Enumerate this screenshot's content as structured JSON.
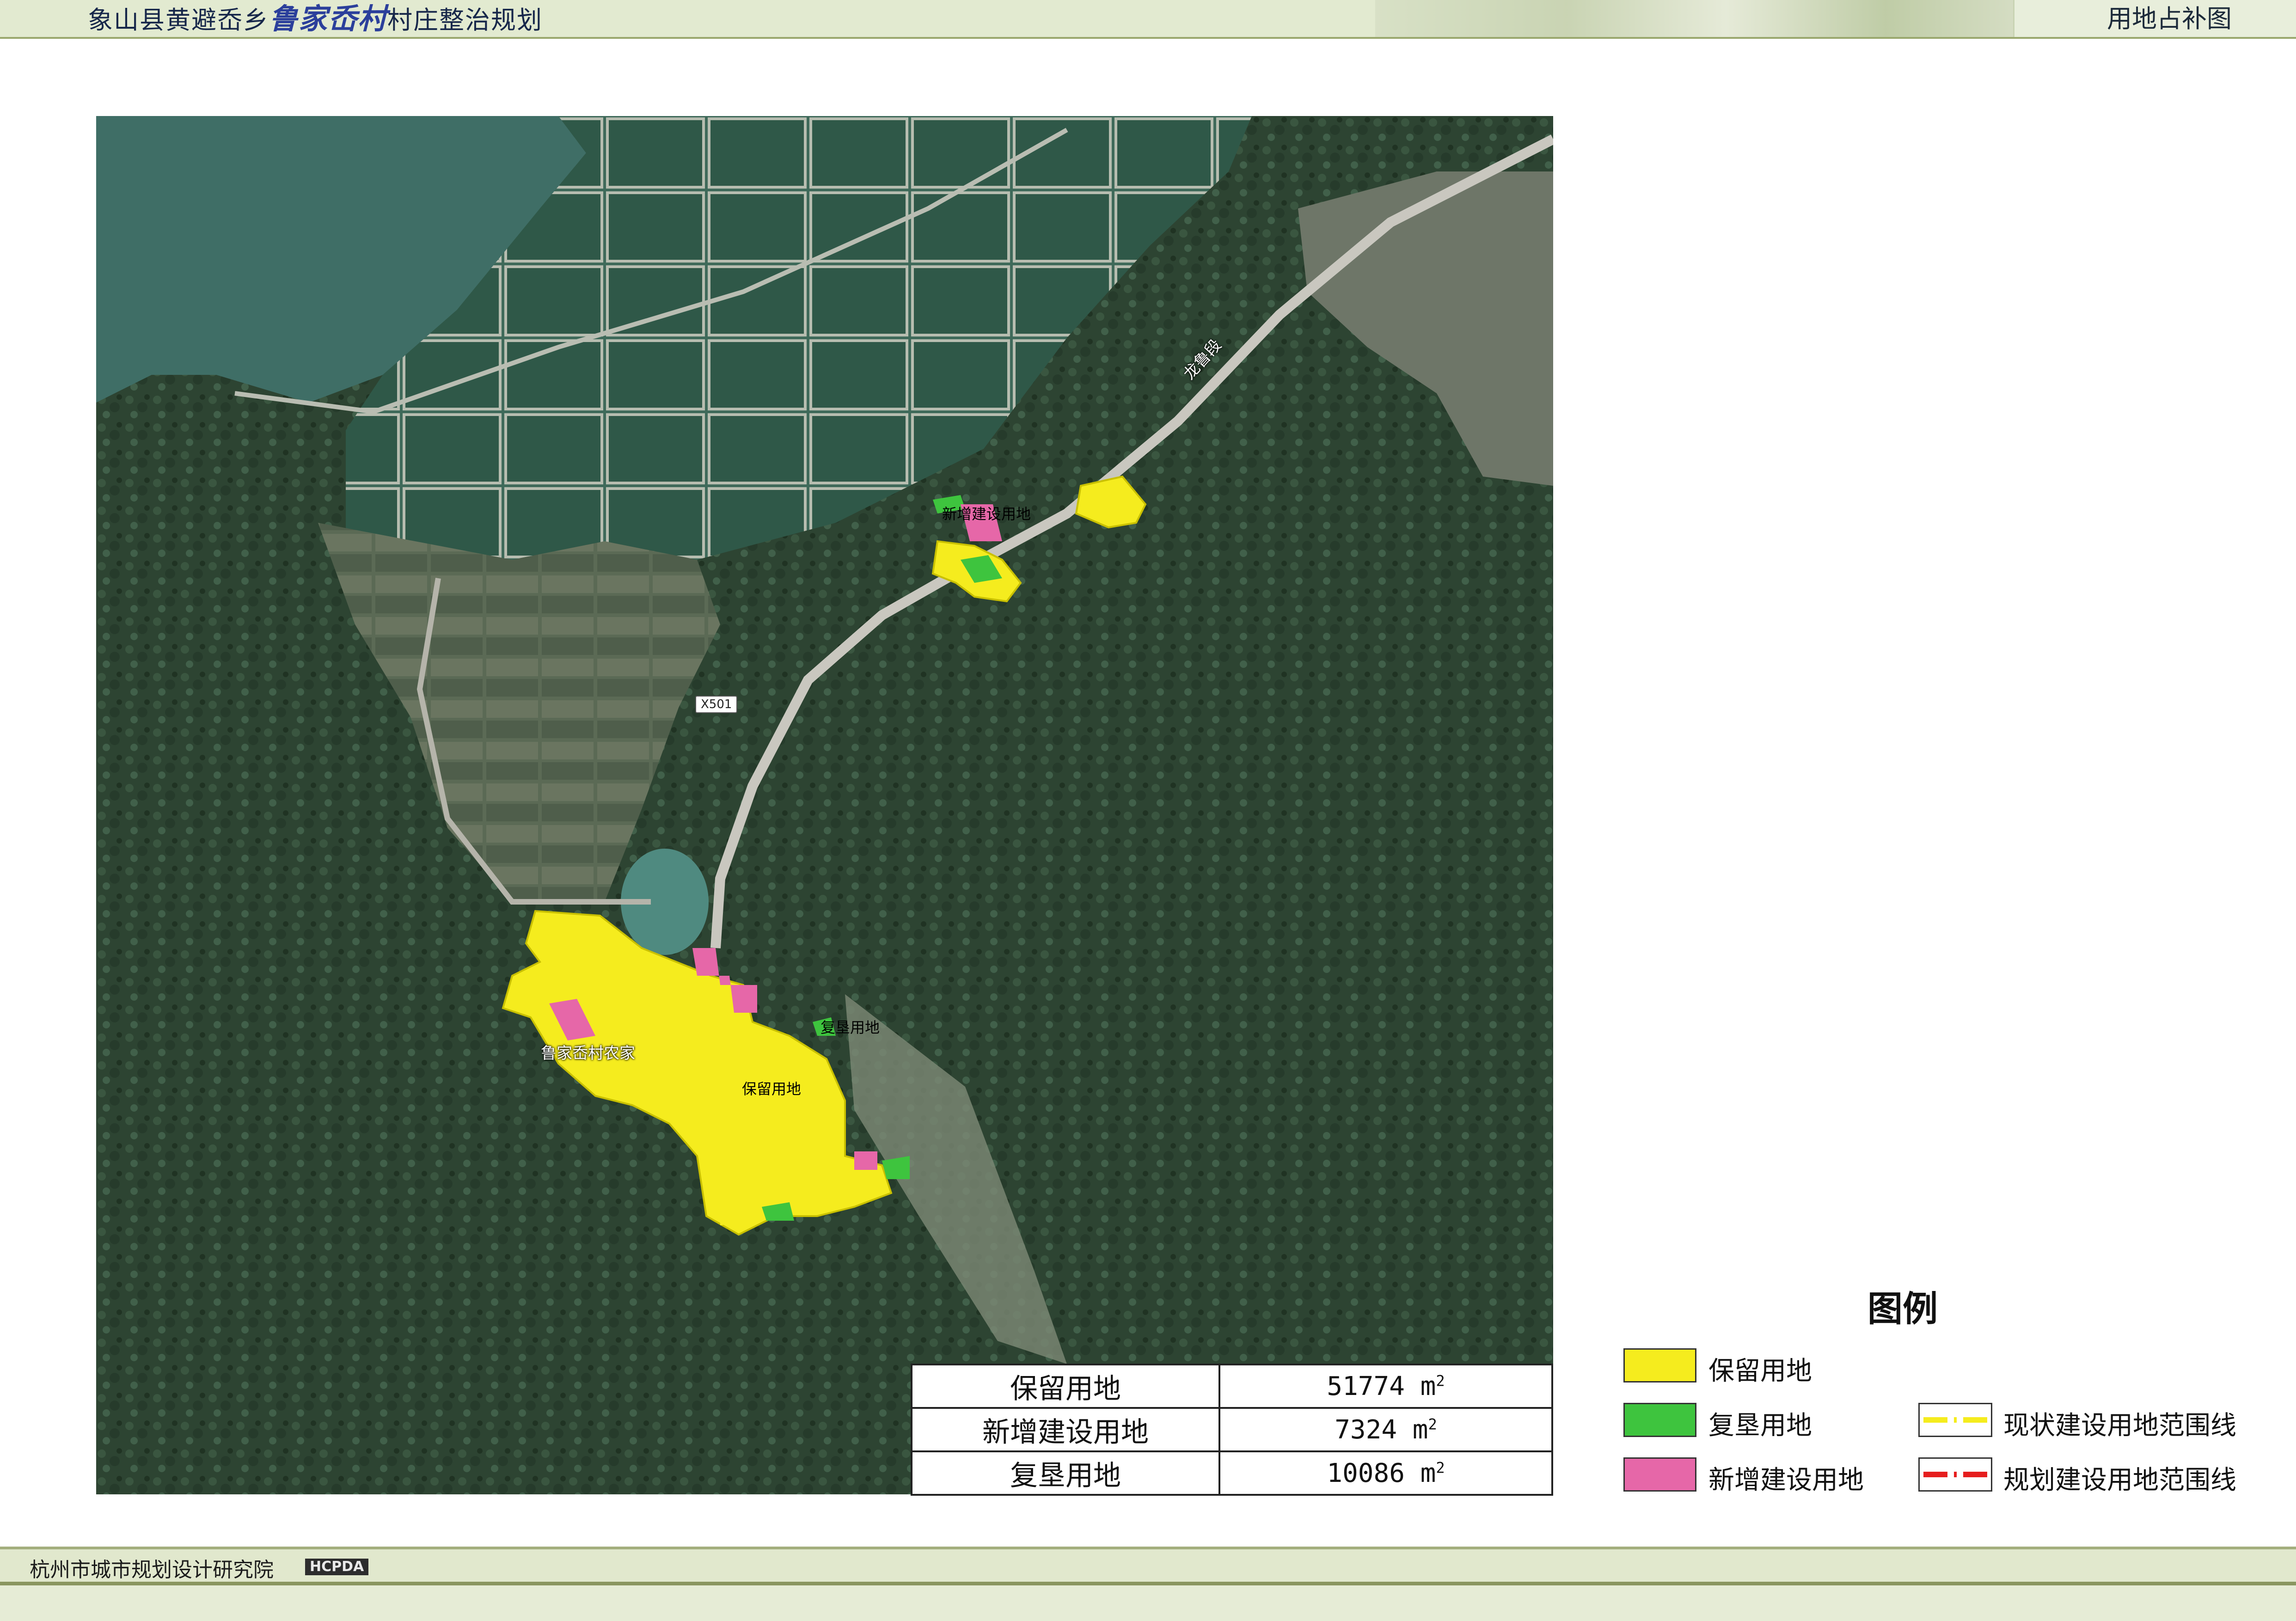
{
  "header": {
    "title_prefix": "象山县黄避岙乡",
    "village": "鲁家岙村",
    "title_suffix": "村庄整治规划",
    "sheet_name": "用地占补图"
  },
  "map": {
    "labels": {
      "new_build": "新增建设用地",
      "reclaim": "复垦用地",
      "retain": "保留用地",
      "road_segment": "龙鲁段",
      "road_shield": "X501",
      "poi": "鲁家岙村农家"
    }
  },
  "area_table": {
    "rows": [
      {
        "name": "保留用地",
        "value": "51774",
        "unit": "m",
        "sup": "2"
      },
      {
        "name": "新增建设用地",
        "value": "7324",
        "unit": "m",
        "sup": "2"
      },
      {
        "name": "复垦用地",
        "value": "10086",
        "unit": "m",
        "sup": "2"
      }
    ]
  },
  "legend": {
    "title": "图例",
    "items": [
      {
        "label": "保留用地",
        "color": "#f5ec1e"
      },
      {
        "label": "复垦用地",
        "color": "#3ec43e"
      },
      {
        "label": "新增建设用地",
        "color": "#e667a8"
      },
      {
        "label": "现状建设用地范围线",
        "color": "#f5ec1e"
      },
      {
        "label": "规划建设用地范围线",
        "color": "#e61e1e"
      }
    ]
  },
  "footer": {
    "institute": "杭州市城市规划设计研究院",
    "badge": "HCPDA"
  },
  "colors": {
    "retain": "#f5ec1e",
    "reclaim": "#3ec43e",
    "new_build": "#e667a8"
  }
}
